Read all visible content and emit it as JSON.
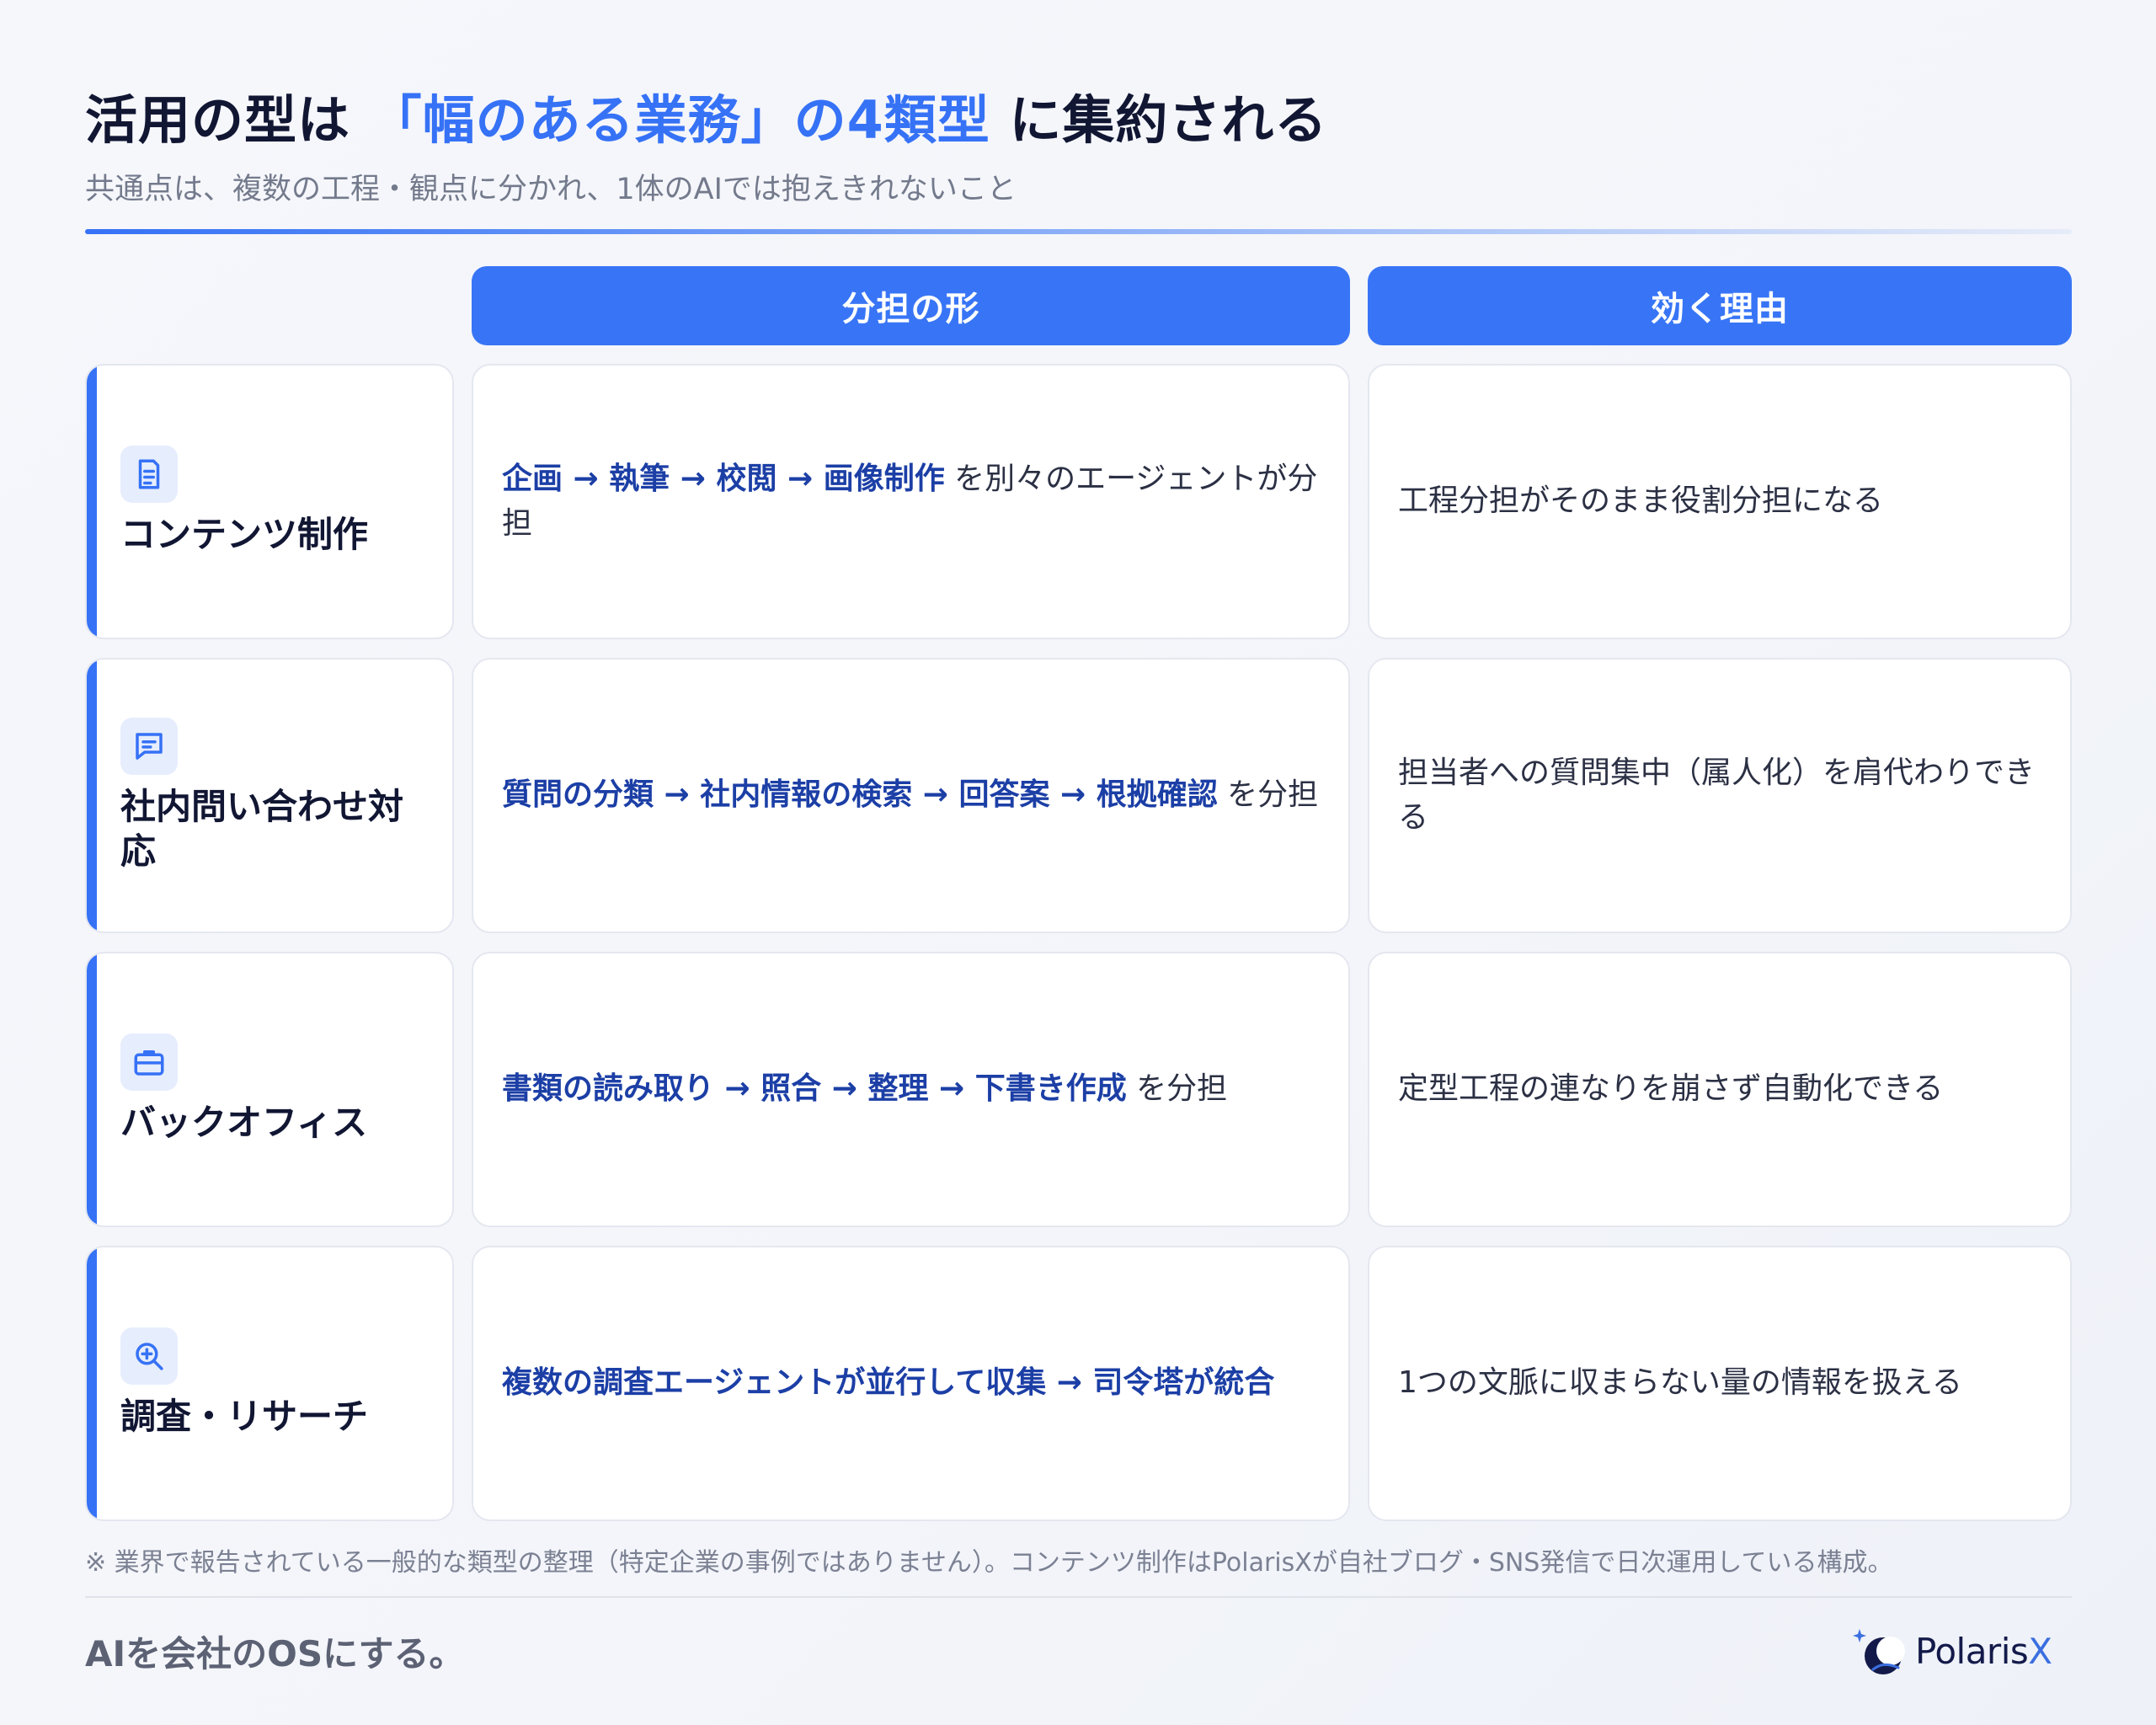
{
  "header": {
    "title_pre": "活用の型は",
    "title_accent": "「幅のある業務」の4類型",
    "title_post": "に集約される",
    "subtitle": "共通点は、複数の工程・観点に分かれ、1体のAIでは抱えきれないこと"
  },
  "columns": [
    "分担の形",
    "効く理由"
  ],
  "rows": [
    {
      "icon": "document-icon",
      "category": "コンテンツ制作",
      "steps": "企画 → 執筆 → 校閲 → 画像制作",
      "steps_suffix": " を別々のエージェントが分担",
      "reason": "工程分担がそのまま役割分担になる"
    },
    {
      "icon": "chat-icon",
      "category": "社内問い合わせ対応",
      "steps": "質問の分類 → 社内情報の検索 → 回答案 → 根拠確認",
      "steps_suffix": " を分担",
      "reason": "担当者への質問集中（属人化）を肩代わりできる"
    },
    {
      "icon": "briefcase-icon",
      "category": "バックオフィス",
      "steps": "書類の読み取り → 照合 → 整理 → 下書き作成",
      "steps_suffix": " を分担",
      "reason": "定型工程の連なりを崩さず自動化できる"
    },
    {
      "icon": "zoom-in-icon",
      "category": "調査・リサーチ",
      "steps": "複数の調査エージェントが並行して収集 → 司令塔が統合",
      "steps_suffix": "",
      "reason": "1つの文脈に収まらない量の情報を扱える"
    }
  ],
  "footer": {
    "note": "※ 業界で報告されている一般的な類型の整理（特定企業の事例ではありません）。コンテンツ制作はPolarisXが自社ブログ・SNS発信で日次運用している構成。",
    "tagline": "AIを会社のOSにする。",
    "logo_text": "Polaris",
    "logo_x": "X"
  },
  "colors": {
    "accent": "#3672f6",
    "step_text": "#1c3fa6",
    "title_text": "#111633"
  }
}
